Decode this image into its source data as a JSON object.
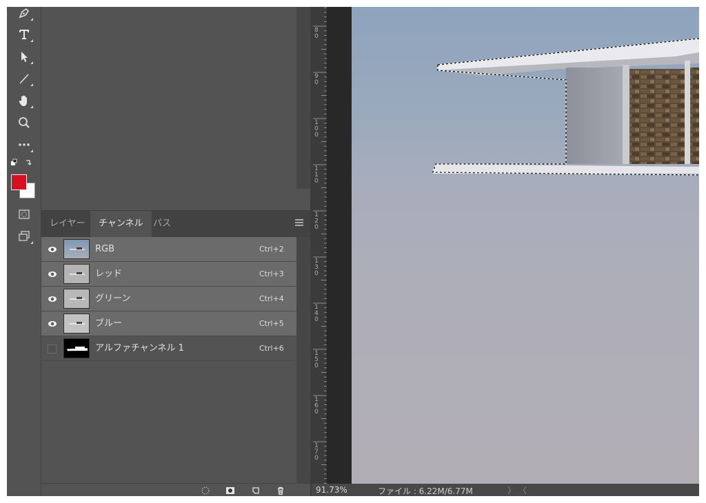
{
  "tabs": [
    {
      "label": "レイヤー"
    },
    {
      "label": "チャンネル"
    },
    {
      "label": "パス"
    }
  ],
  "channels": [
    {
      "name": "RGB",
      "shortcut": "Ctrl+2"
    },
    {
      "name": "レッド",
      "shortcut": "Ctrl+3"
    },
    {
      "name": "グリーン",
      "shortcut": "Ctrl+4"
    },
    {
      "name": "ブルー",
      "shortcut": "Ctrl+5"
    },
    {
      "name": "アルファチャンネル 1",
      "shortcut": "Ctrl+6"
    }
  ],
  "ruler": {
    "labels": [
      "8\n0",
      "9\n0",
      "1\n0\n0",
      "1\n1\n0",
      "1\n2\n0",
      "1\n3\n0",
      "1\n4\n0",
      "1\n5\n0",
      "1\n6\n0",
      "1\n7\n0"
    ]
  },
  "status": {
    "zoom": "91.73%",
    "file": "ファイル : 6.22M/6.77M",
    "arrows": "〉 〈"
  },
  "colors": {
    "foreground": "#d7101f",
    "background": "#ffffff"
  },
  "icons": [
    "pen-icon",
    "type-icon",
    "path-selection-icon",
    "line-icon",
    "hand-icon",
    "zoom-icon",
    "more-tools-icon",
    "quick-mask-icon",
    "screen-mode-icon"
  ]
}
